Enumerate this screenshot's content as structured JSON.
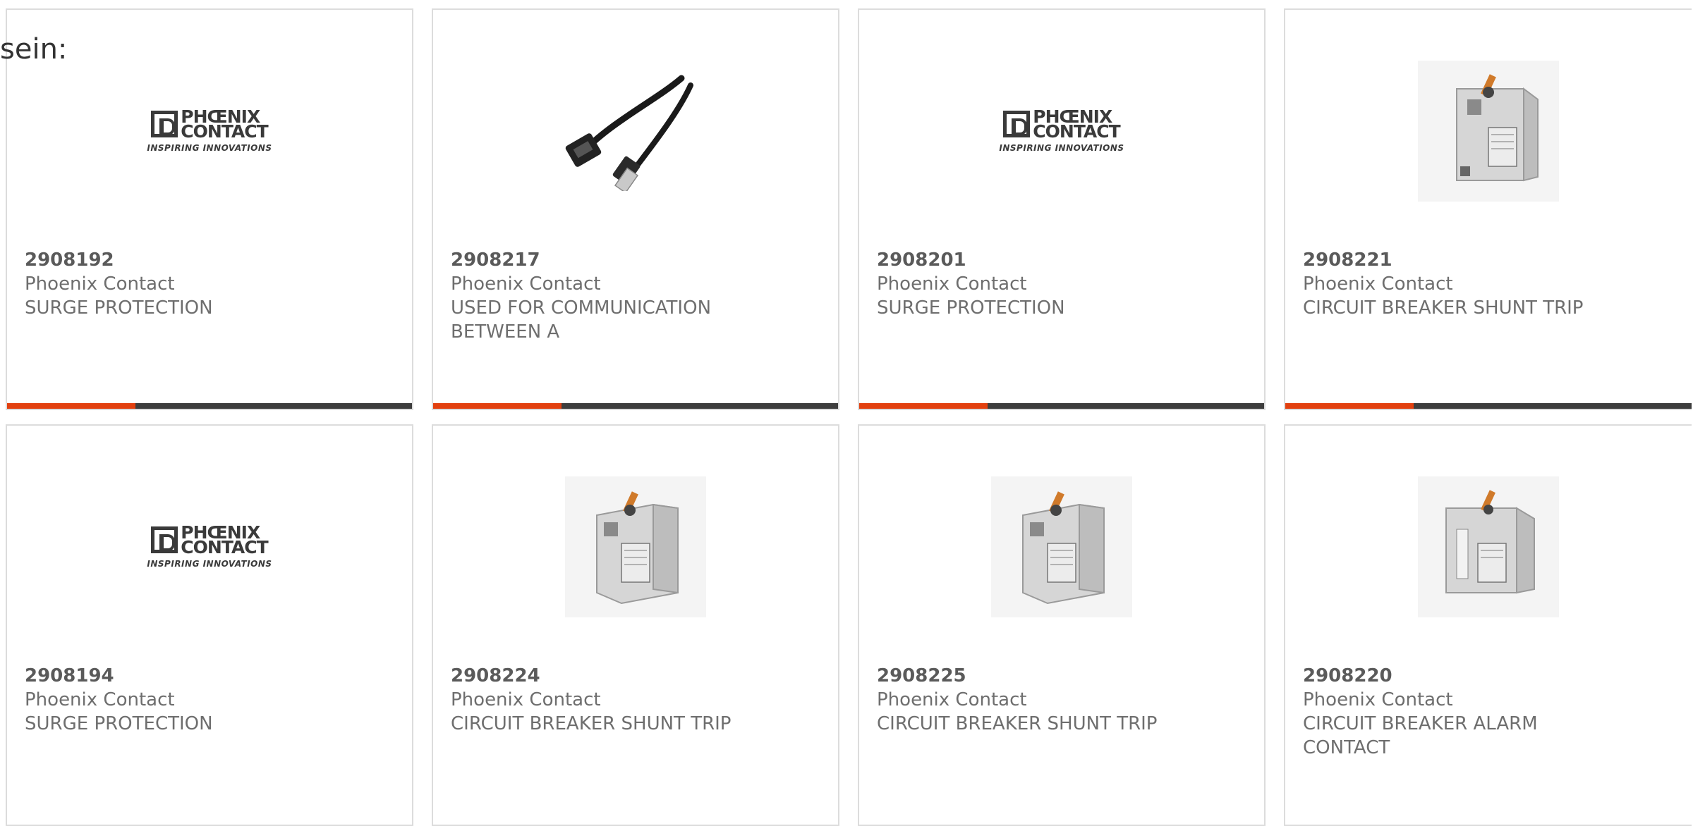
{
  "heading_fragment": "sein:",
  "logo": {
    "line1": "PHŒNIX",
    "line2": "CONTACT",
    "tagline": "INSPIRING INNOVATIONS"
  },
  "colors": {
    "accent": "#e2400f",
    "bar": "#3d3d3d",
    "border": "#dcdcdc",
    "text": "#6e6e6e"
  },
  "products": [
    {
      "part": "2908192",
      "brand": "Phoenix Contact",
      "desc": "SURGE PROTECTION",
      "image": "phoenix-contact-logo"
    },
    {
      "part": "2908217",
      "brand": "Phoenix Contact",
      "desc": "USED FOR COMMUNICATION BETWEEN A",
      "image": "usb-cable-photo"
    },
    {
      "part": "2908201",
      "brand": "Phoenix Contact",
      "desc": "SURGE PROTECTION",
      "image": "phoenix-contact-logo"
    },
    {
      "part": "2908221",
      "brand": "Phoenix Contact",
      "desc": "CIRCUIT BREAKER SHUNT TRIP",
      "image": "circuit-breaker-photo"
    },
    {
      "part": "2908194",
      "brand": "Phoenix Contact",
      "desc": "SURGE PROTECTION",
      "image": "phoenix-contact-logo"
    },
    {
      "part": "2908224",
      "brand": "Phoenix Contact",
      "desc": "CIRCUIT BREAKER SHUNT TRIP",
      "image": "circuit-breaker-photo"
    },
    {
      "part": "2908225",
      "brand": "Phoenix Contact",
      "desc": "CIRCUIT BREAKER SHUNT TRIP",
      "image": "circuit-breaker-photo"
    },
    {
      "part": "2908220",
      "brand": "Phoenix Contact",
      "desc": "CIRCUIT BREAKER ALARM CONTACT",
      "image": "circuit-breaker-photo"
    }
  ]
}
